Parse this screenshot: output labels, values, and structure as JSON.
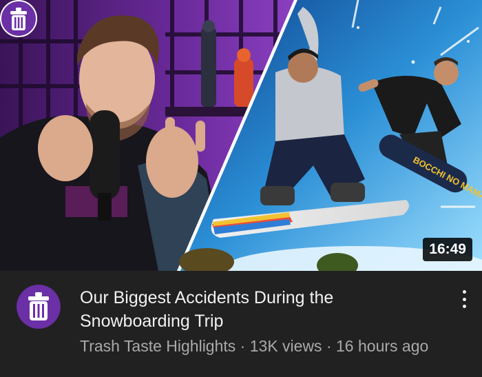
{
  "video": {
    "title": "Our Biggest Accidents During the Snowboarding Trip",
    "duration": "16:49",
    "channel": "Trash Taste Highlights",
    "views": "13K views",
    "age": "16 hours ago",
    "separator": " · "
  },
  "thumbnail": {
    "board_text": "BOCCHI NO MAMA"
  },
  "colors": {
    "background": "#212121",
    "title": "#f1f1f1",
    "meta": "#aaaaaa",
    "brand_purple": "#6b2fa6"
  },
  "icons": {
    "channel_logo": "trash-can-icon",
    "menu": "more-vert-icon"
  }
}
